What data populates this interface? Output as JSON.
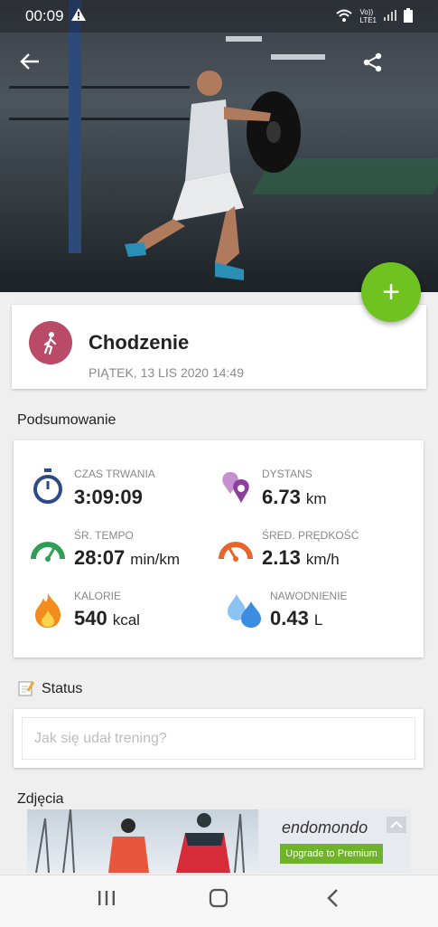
{
  "status_bar": {
    "time": "00:09",
    "network": "Vo))\nLTE1"
  },
  "activity": {
    "title": "Chodzenie",
    "date": "PIĄTEK, 13 LIS 2020 14:49"
  },
  "summary": {
    "title": "Podsumowanie",
    "metrics": [
      {
        "label": "CZAS TRWANIA",
        "value": "3:09:09",
        "unit": "",
        "icon": "stopwatch-icon",
        "color": "#2b4a86"
      },
      {
        "label": "DYSTANS",
        "value": "6.73",
        "unit": "km",
        "icon": "map-pins-icon",
        "color": "#8e3f9c"
      },
      {
        "label": "ŚR. TEMPO",
        "value": "28:07",
        "unit": "min/km",
        "icon": "speedometer-green-icon",
        "color": "#2f9e57"
      },
      {
        "label": "ŚRED. PRĘDKOŚĆ",
        "value": "2.13",
        "unit": "km/h",
        "icon": "speedometer-orange-icon",
        "color": "#e6652a"
      },
      {
        "label": "KALORIE",
        "value": "540",
        "unit": "kcal",
        "icon": "flame-icon",
        "color": "#f28c1d"
      },
      {
        "label": "NAWODNIENIE",
        "value": "0.43",
        "unit": "L",
        "icon": "water-drops-icon",
        "color": "#3a8de0"
      }
    ]
  },
  "status_section": {
    "title": "Status",
    "placeholder": "Jak się udał trening?"
  },
  "photos_section": {
    "title": "Zdjęcia"
  },
  "ad": {
    "brand_prefix": "",
    "brand": "endomondo",
    "cta": "Upgrade to Premium"
  },
  "colors": {
    "accent": "#6fc21f",
    "activity": "#b94b68"
  }
}
